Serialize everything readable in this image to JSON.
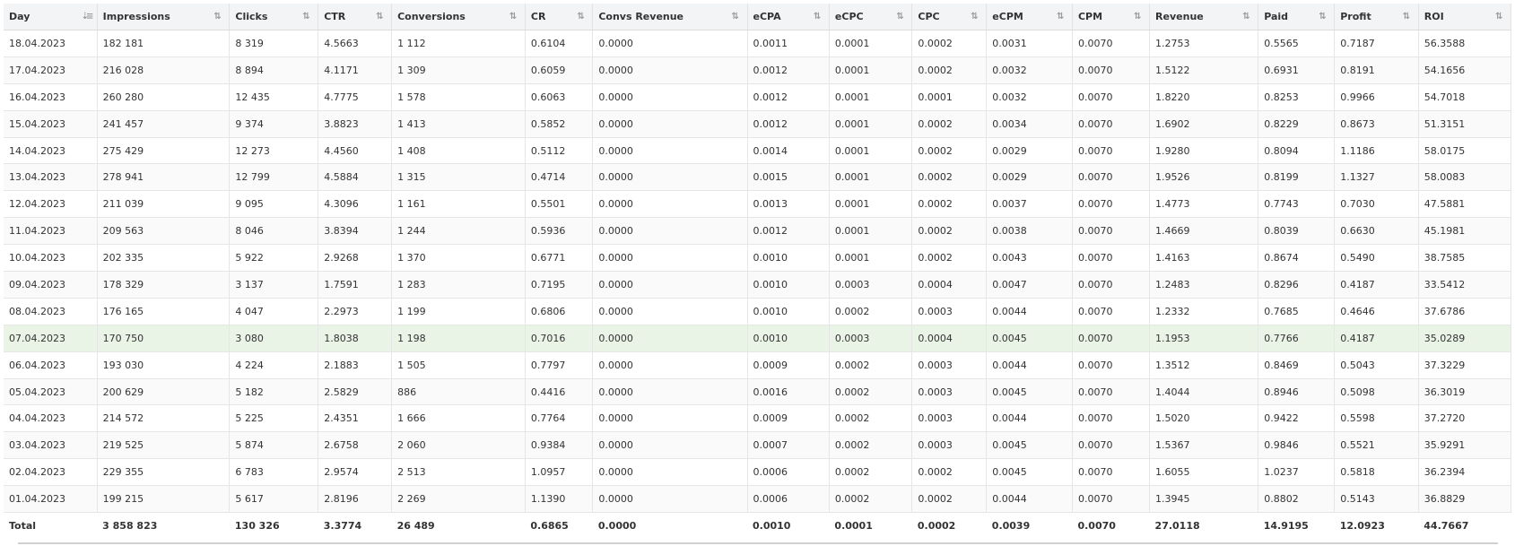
{
  "columns": [
    "Day",
    "Impressions",
    "Clicks",
    "CTR",
    "Conversions",
    "CR",
    "Convs Revenue",
    "eCPA",
    "eCPC",
    "CPC",
    "eCPM",
    "CPM",
    "Revenue",
    "Paid",
    "Profit",
    "ROI"
  ],
  "rows": [
    [
      "18.04.2023",
      "182 181",
      "8 319",
      "4.5663",
      "1 112",
      "0.6104",
      "0.0000",
      "0.0011",
      "0.0001",
      "0.0002",
      "0.0031",
      "0.0070",
      "1.2753",
      "0.5565",
      "0.7187",
      "56.3588"
    ],
    [
      "17.04.2023",
      "216 028",
      "8 894",
      "4.1171",
      "1 309",
      "0.6059",
      "0.0000",
      "0.0012",
      "0.0001",
      "0.0002",
      "0.0032",
      "0.0070",
      "1.5122",
      "0.6931",
      "0.8191",
      "54.1656"
    ],
    [
      "16.04.2023",
      "260 280",
      "12 435",
      "4.7775",
      "1 578",
      "0.6063",
      "0.0000",
      "0.0012",
      "0.0001",
      "0.0001",
      "0.0032",
      "0.0070",
      "1.8220",
      "0.8253",
      "0.9966",
      "54.7018"
    ],
    [
      "15.04.2023",
      "241 457",
      "9 374",
      "3.8823",
      "1 413",
      "0.5852",
      "0.0000",
      "0.0012",
      "0.0001",
      "0.0002",
      "0.0034",
      "0.0070",
      "1.6902",
      "0.8229",
      "0.8673",
      "51.3151"
    ],
    [
      "14.04.2023",
      "275 429",
      "12 273",
      "4.4560",
      "1 408",
      "0.5112",
      "0.0000",
      "0.0014",
      "0.0001",
      "0.0002",
      "0.0029",
      "0.0070",
      "1.9280",
      "0.8094",
      "1.1186",
      "58.0175"
    ],
    [
      "13.04.2023",
      "278 941",
      "12 799",
      "4.5884",
      "1 315",
      "0.4714",
      "0.0000",
      "0.0015",
      "0.0001",
      "0.0002",
      "0.0029",
      "0.0070",
      "1.9526",
      "0.8199",
      "1.1327",
      "58.0083"
    ],
    [
      "12.04.2023",
      "211 039",
      "9 095",
      "4.3096",
      "1 161",
      "0.5501",
      "0.0000",
      "0.0013",
      "0.0001",
      "0.0002",
      "0.0037",
      "0.0070",
      "1.4773",
      "0.7743",
      "0.7030",
      "47.5881"
    ],
    [
      "11.04.2023",
      "209 563",
      "8 046",
      "3.8394",
      "1 244",
      "0.5936",
      "0.0000",
      "0.0012",
      "0.0001",
      "0.0002",
      "0.0038",
      "0.0070",
      "1.4669",
      "0.8039",
      "0.6630",
      "45.1981"
    ],
    [
      "10.04.2023",
      "202 335",
      "5 922",
      "2.9268",
      "1 370",
      "0.6771",
      "0.0000",
      "0.0010",
      "0.0001",
      "0.0002",
      "0.0043",
      "0.0070",
      "1.4163",
      "0.8674",
      "0.5490",
      "38.7585"
    ],
    [
      "09.04.2023",
      "178 329",
      "3 137",
      "1.7591",
      "1 283",
      "0.7195",
      "0.0000",
      "0.0010",
      "0.0003",
      "0.0004",
      "0.0047",
      "0.0070",
      "1.2483",
      "0.8296",
      "0.4187",
      "33.5412"
    ],
    [
      "08.04.2023",
      "176 165",
      "4 047",
      "2.2973",
      "1 199",
      "0.6806",
      "0.0000",
      "0.0010",
      "0.0002",
      "0.0003",
      "0.0044",
      "0.0070",
      "1.2332",
      "0.7685",
      "0.4646",
      "37.6786"
    ],
    [
      "07.04.2023",
      "170 750",
      "3 080",
      "1.8038",
      "1 198",
      "0.7016",
      "0.0000",
      "0.0010",
      "0.0003",
      "0.0004",
      "0.0045",
      "0.0070",
      "1.1953",
      "0.7766",
      "0.4187",
      "35.0289"
    ],
    [
      "06.04.2023",
      "193 030",
      "4 224",
      "2.1883",
      "1 505",
      "0.7797",
      "0.0000",
      "0.0009",
      "0.0002",
      "0.0003",
      "0.0044",
      "0.0070",
      "1.3512",
      "0.8469",
      "0.5043",
      "37.3229"
    ],
    [
      "05.04.2023",
      "200 629",
      "5 182",
      "2.5829",
      "886",
      "0.4416",
      "0.0000",
      "0.0016",
      "0.0002",
      "0.0003",
      "0.0045",
      "0.0070",
      "1.4044",
      "0.8946",
      "0.5098",
      "36.3019"
    ],
    [
      "04.04.2023",
      "214 572",
      "5 225",
      "2.4351",
      "1 666",
      "0.7764",
      "0.0000",
      "0.0009",
      "0.0002",
      "0.0003",
      "0.0044",
      "0.0070",
      "1.5020",
      "0.9422",
      "0.5598",
      "37.2720"
    ],
    [
      "03.04.2023",
      "219 525",
      "5 874",
      "2.6758",
      "2 060",
      "0.9384",
      "0.0000",
      "0.0007",
      "0.0002",
      "0.0003",
      "0.0045",
      "0.0070",
      "1.5367",
      "0.9846",
      "0.5521",
      "35.9291"
    ],
    [
      "02.04.2023",
      "229 355",
      "6 783",
      "2.9574",
      "2 513",
      "1.0957",
      "0.0000",
      "0.0006",
      "0.0002",
      "0.0002",
      "0.0045",
      "0.0070",
      "1.6055",
      "1.0237",
      "0.5818",
      "36.2394"
    ],
    [
      "01.04.2023",
      "199 215",
      "5 617",
      "2.8196",
      "2 269",
      "1.1390",
      "0.0000",
      "0.0006",
      "0.0002",
      "0.0002",
      "0.0044",
      "0.0070",
      "1.3945",
      "0.8802",
      "0.5143",
      "36.8829"
    ]
  ],
  "highlighted_row": "07.04.2023",
  "total": [
    "Total",
    "3 858 823",
    "130 326",
    "3.3774",
    "26 489",
    "0.6865",
    "0.0000",
    "0.0010",
    "0.0001",
    "0.0002",
    "0.0039",
    "0.0070",
    "27.0118",
    "14.9195",
    "12.0923",
    "44.7667"
  ],
  "icons": {
    "sort": "sort-arrows-icon",
    "sort_active": "sort-desc-icon"
  },
  "colors": {
    "header_bg": "#f3f4f6",
    "highlight_row": "#e9f3e6",
    "border": "#e6e6e6"
  }
}
